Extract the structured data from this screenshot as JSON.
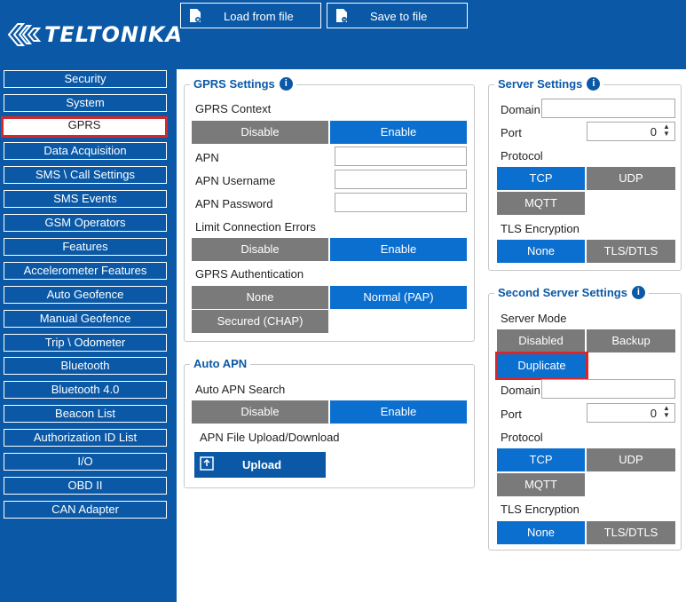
{
  "brand": {
    "logo_text": "TELTONIKA"
  },
  "toolbar": {
    "load_label": "Load from file",
    "save_label": "Save to file"
  },
  "sidebar": {
    "items": [
      {
        "label": "Security"
      },
      {
        "label": "System"
      },
      {
        "label": "GPRS",
        "active": true
      },
      {
        "label": "Data Acquisition"
      },
      {
        "label": "SMS \\ Call Settings"
      },
      {
        "label": "SMS Events"
      },
      {
        "label": "GSM Operators"
      },
      {
        "label": "Features"
      },
      {
        "label": "Accelerometer Features"
      },
      {
        "label": "Auto Geofence"
      },
      {
        "label": "Manual Geofence"
      },
      {
        "label": "Trip \\ Odometer"
      },
      {
        "label": "Bluetooth"
      },
      {
        "label": "Bluetooth 4.0"
      },
      {
        "label": "Beacon List"
      },
      {
        "label": "Authorization ID List"
      },
      {
        "label": "I/O"
      },
      {
        "label": "OBD II"
      },
      {
        "label": "CAN Adapter"
      }
    ]
  },
  "gprs": {
    "title": "GPRS Settings",
    "context_label": "GPRS Context",
    "context_disable": "Disable",
    "context_enable": "Enable",
    "apn_label": "APN",
    "apn_value": "",
    "apn_user_label": "APN Username",
    "apn_user_value": "",
    "apn_pass_label": "APN Password",
    "apn_pass_value": "",
    "limit_label": "Limit Connection Errors",
    "limit_disable": "Disable",
    "limit_enable": "Enable",
    "auth_label": "GPRS Authentication",
    "auth_none": "None",
    "auth_pap": "Normal (PAP)",
    "auth_chap": "Secured (CHAP)"
  },
  "auto_apn": {
    "title": "Auto APN",
    "search_label": "Auto APN Search",
    "disable": "Disable",
    "enable": "Enable",
    "file_label": "APN File Upload/Download",
    "upload_label": "Upload"
  },
  "server": {
    "title": "Server Settings",
    "domain_label": "Domain",
    "domain_value": "",
    "port_label": "Port",
    "port_value": "0",
    "protocol_label": "Protocol",
    "tcp": "TCP",
    "udp": "UDP",
    "mqtt": "MQTT",
    "tls_label": "TLS Encryption",
    "tls_none": "None",
    "tls_dtls": "TLS/DTLS"
  },
  "second_server": {
    "title": "Second Server Settings",
    "mode_label": "Server Mode",
    "disabled": "Disabled",
    "backup": "Backup",
    "duplicate": "Duplicate",
    "domain_label": "Domain",
    "domain_value": "",
    "port_label": "Port",
    "port_value": "0",
    "protocol_label": "Protocol",
    "tcp": "TCP",
    "udp": "UDP",
    "mqtt": "MQTT",
    "tls_label": "TLS Encryption",
    "tls_none": "None",
    "tls_dtls": "TLS/DTLS"
  },
  "colors": {
    "brand_blue": "#0b59a6",
    "active_blue": "#0b6fcf",
    "inactive_gray": "#7a7a7a",
    "highlight_red": "#d62828"
  }
}
